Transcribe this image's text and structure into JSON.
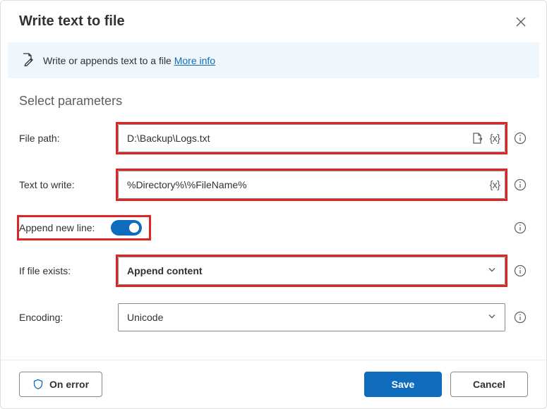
{
  "header": {
    "title": "Write text to file"
  },
  "infobar": {
    "text": "Write or appends text to a file ",
    "link": "More info"
  },
  "section_title": "Select parameters",
  "rows": {
    "file_path": {
      "label": "File path:",
      "value": "D:\\Backup\\Logs.txt"
    },
    "text_to_write": {
      "label": "Text to write:",
      "value": "%Directory%\\%FileName%"
    },
    "append_new_line": {
      "label": "Append new line:",
      "value": true
    },
    "if_file_exists": {
      "label": "If file exists:",
      "value": "Append content"
    },
    "encoding": {
      "label": "Encoding:",
      "value": "Unicode"
    }
  },
  "footer": {
    "on_error": "On error",
    "save": "Save",
    "cancel": "Cancel"
  }
}
